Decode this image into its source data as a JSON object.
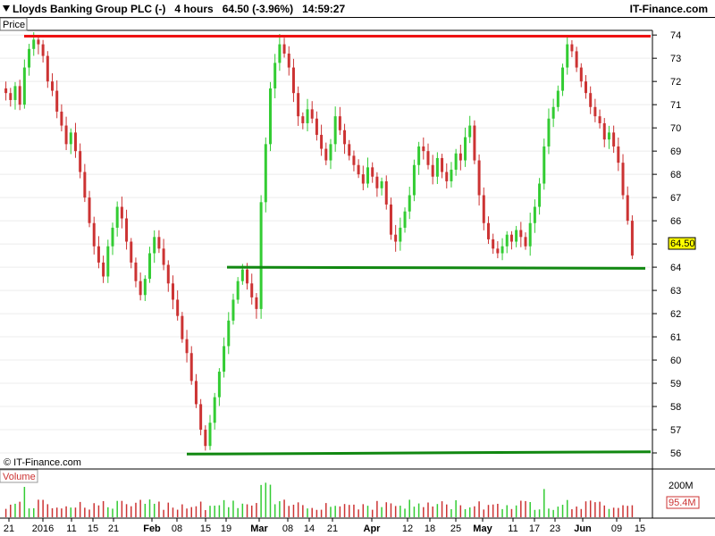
{
  "header": {
    "title": "Lloyds Banking Group PLC (-)",
    "interval": "4 hours",
    "last_change": "64.50 (-3.96%)",
    "time": "14:59:27",
    "brand": "IT-Finance.com"
  },
  "panels": {
    "price_label": "Price",
    "volume_label": "Volume",
    "watermark": "© IT-Finance.com"
  },
  "colors": {
    "up_candle": "#33cc33",
    "down_candle": "#cc3333",
    "resistance_line": "#ee1111",
    "support_line": "#118811",
    "last_price_badge": "#ffff00"
  },
  "chart_data": {
    "type": "candlestick",
    "price_axis": {
      "ylim": [
        55.5,
        74.2
      ],
      "ticks": [
        "74",
        "73",
        "72",
        "71",
        "70",
        "69",
        "68",
        "67",
        "66",
        "65",
        "64",
        "63",
        "62",
        "61",
        "60",
        "59",
        "58",
        "57",
        "56"
      ]
    },
    "last_price": "64.50",
    "volume_axis": {
      "tick_label": "200M",
      "last_volume": "95.4M"
    },
    "x_axis": {
      "ticks": [
        "21",
        "2016",
        "11",
        "15",
        "21",
        "Feb",
        "08",
        "15",
        "19",
        "Mar",
        "08",
        "14",
        "21",
        "Apr",
        "12",
        "18",
        "25",
        "May",
        "11",
        "17",
        "23",
        "Jun",
        "09",
        "15"
      ]
    },
    "trend_lines": [
      {
        "name": "resistance",
        "y_start": 73.95,
        "y_end": 73.95
      },
      {
        "name": "upper-support",
        "y_start": 64.0,
        "y_end": 63.95
      },
      {
        "name": "lower-support",
        "y_start": 55.95,
        "y_end": 56.05
      }
    ],
    "closes": [
      71.5,
      71.2,
      71.8,
      71.0,
      72.6,
      73.4,
      73.8,
      73.6,
      73.1,
      72.0,
      71.6,
      70.7,
      70.1,
      69.3,
      69.8,
      69.0,
      68.1,
      67.0,
      65.9,
      64.9,
      64.2,
      63.6,
      64.9,
      65.7,
      66.6,
      66.1,
      65.1,
      64.2,
      63.4,
      62.8,
      63.5,
      64.6,
      65.3,
      64.8,
      64.1,
      63.3,
      62.6,
      61.9,
      60.9,
      60.3,
      59.1,
      58.1,
      57.0,
      56.3,
      57.3,
      58.4,
      59.5,
      60.6,
      61.7,
      62.6,
      63.4,
      63.9,
      63.3,
      62.7,
      62.2,
      66.8,
      69.3,
      71.7,
      72.8,
      73.6,
      73.2,
      72.6,
      71.5,
      70.5,
      70.2,
      70.8,
      70.4,
      69.7,
      69.1,
      68.6,
      69.3,
      70.5,
      69.9,
      69.3,
      68.8,
      68.4,
      68.0,
      67.6,
      68.3,
      67.9,
      67.4,
      67.7,
      66.7,
      65.4,
      65.1,
      65.7,
      66.4,
      67.1,
      68.4,
      69.2,
      69.0,
      68.4,
      67.9,
      68.7,
      68.1,
      67.7,
      68.2,
      68.9,
      68.6,
      69.6,
      70.1,
      68.6,
      67.1,
      65.9,
      65.2,
      64.8,
      64.6,
      64.9,
      65.4,
      65.1,
      65.6,
      65.3,
      64.9,
      65.9,
      66.6,
      67.6,
      69.2,
      70.4,
      70.9,
      71.6,
      72.6,
      73.6,
      73.3,
      72.6,
      72.0,
      71.5,
      70.9,
      70.5,
      70.2,
      69.5,
      69.8,
      69.2,
      68.5,
      67.1,
      66.0,
      64.5
    ]
  }
}
